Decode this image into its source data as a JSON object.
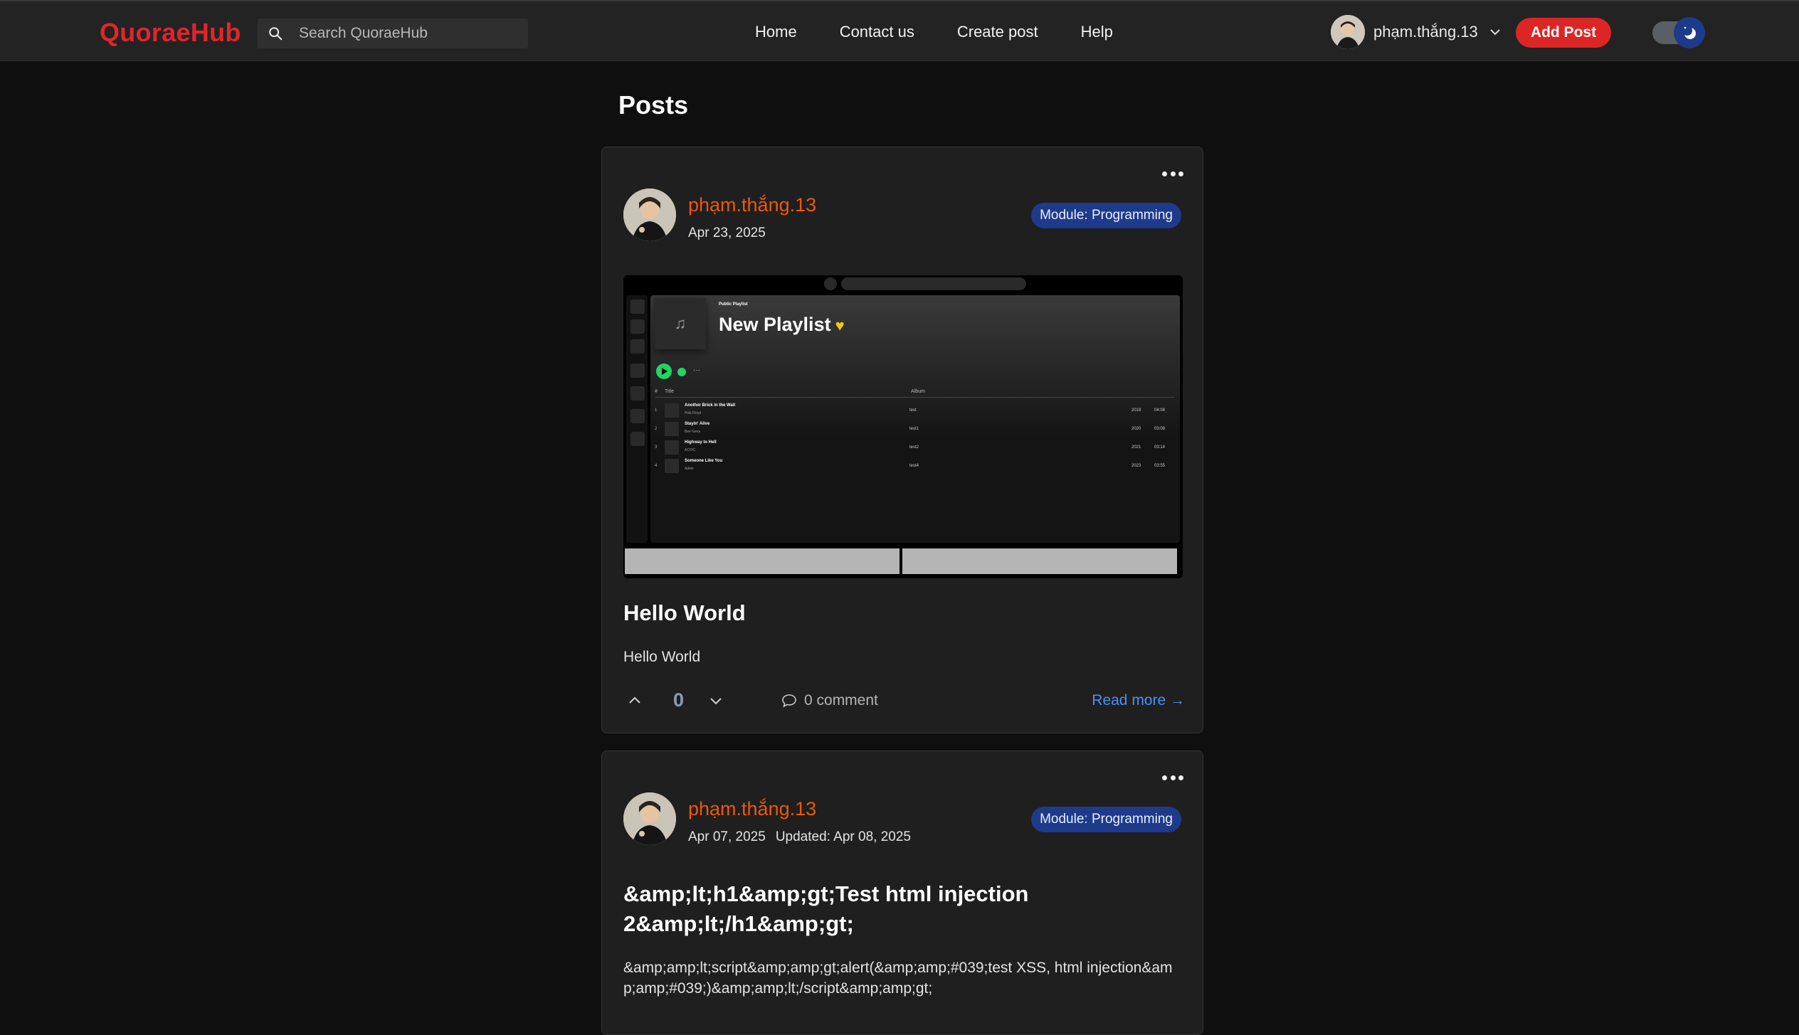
{
  "brand": "QuoraeHub",
  "search": {
    "placeholder": "Search QuoraeHub"
  },
  "nav": {
    "home": "Home",
    "contact": "Contact us",
    "create": "Create post",
    "help": "Help"
  },
  "user": {
    "name": "phạm.thắng.13"
  },
  "actions": {
    "add_post": "Add Post"
  },
  "theme": {
    "mode": "dark"
  },
  "main": {
    "title": "Posts"
  },
  "posts": [
    {
      "author": "phạm.thắng.13",
      "date": "Apr 23, 2025",
      "updated": "",
      "module": "Module: Programming",
      "title": "Hello World",
      "body": "Hello World",
      "votes": "0",
      "comments": "0 comment",
      "read_more": "Read more →",
      "image": {
        "label": "Public Playlist",
        "title": "New Playlist",
        "col_hash": "#",
        "col_title": "Title",
        "col_album": "Album",
        "tracks": [
          {
            "n": "1",
            "title": "Another Brick in the Wall",
            "artist": "Pink Floyd",
            "album": "test",
            "year": "2019",
            "dur": "04:08"
          },
          {
            "n": "2",
            "title": "Stayin' Alive",
            "artist": "Bee Gees",
            "album": "test1",
            "year": "2020",
            "dur": "03:08"
          },
          {
            "n": "3",
            "title": "Highway to Hell",
            "artist": "AC/DC",
            "album": "test2",
            "year": "2021",
            "dur": "03:14"
          },
          {
            "n": "4",
            "title": "Someone Like You",
            "artist": "Adele",
            "album": "test4",
            "year": "2023",
            "dur": "03:55"
          }
        ]
      }
    },
    {
      "author": "phạm.thắng.13",
      "date": "Apr 07, 2025",
      "updated": "Updated: Apr 08, 2025",
      "module": "Module: Programming",
      "title": "&amp;lt;h1&amp;gt;Test html injection 2&amp;lt;/h1&amp;gt;",
      "body": "&amp;amp;lt;script&amp;amp;gt;alert(&amp;amp;#039;test XSS, html injection&amp;amp;#039;)&amp;amp;lt;/script&amp;amp;gt;"
    }
  ],
  "colors": {
    "brand": "#e0262a",
    "author": "#ea580c",
    "badge": "#1e3a8a",
    "link": "#4f8ff7",
    "add_post": "#dc2626"
  }
}
